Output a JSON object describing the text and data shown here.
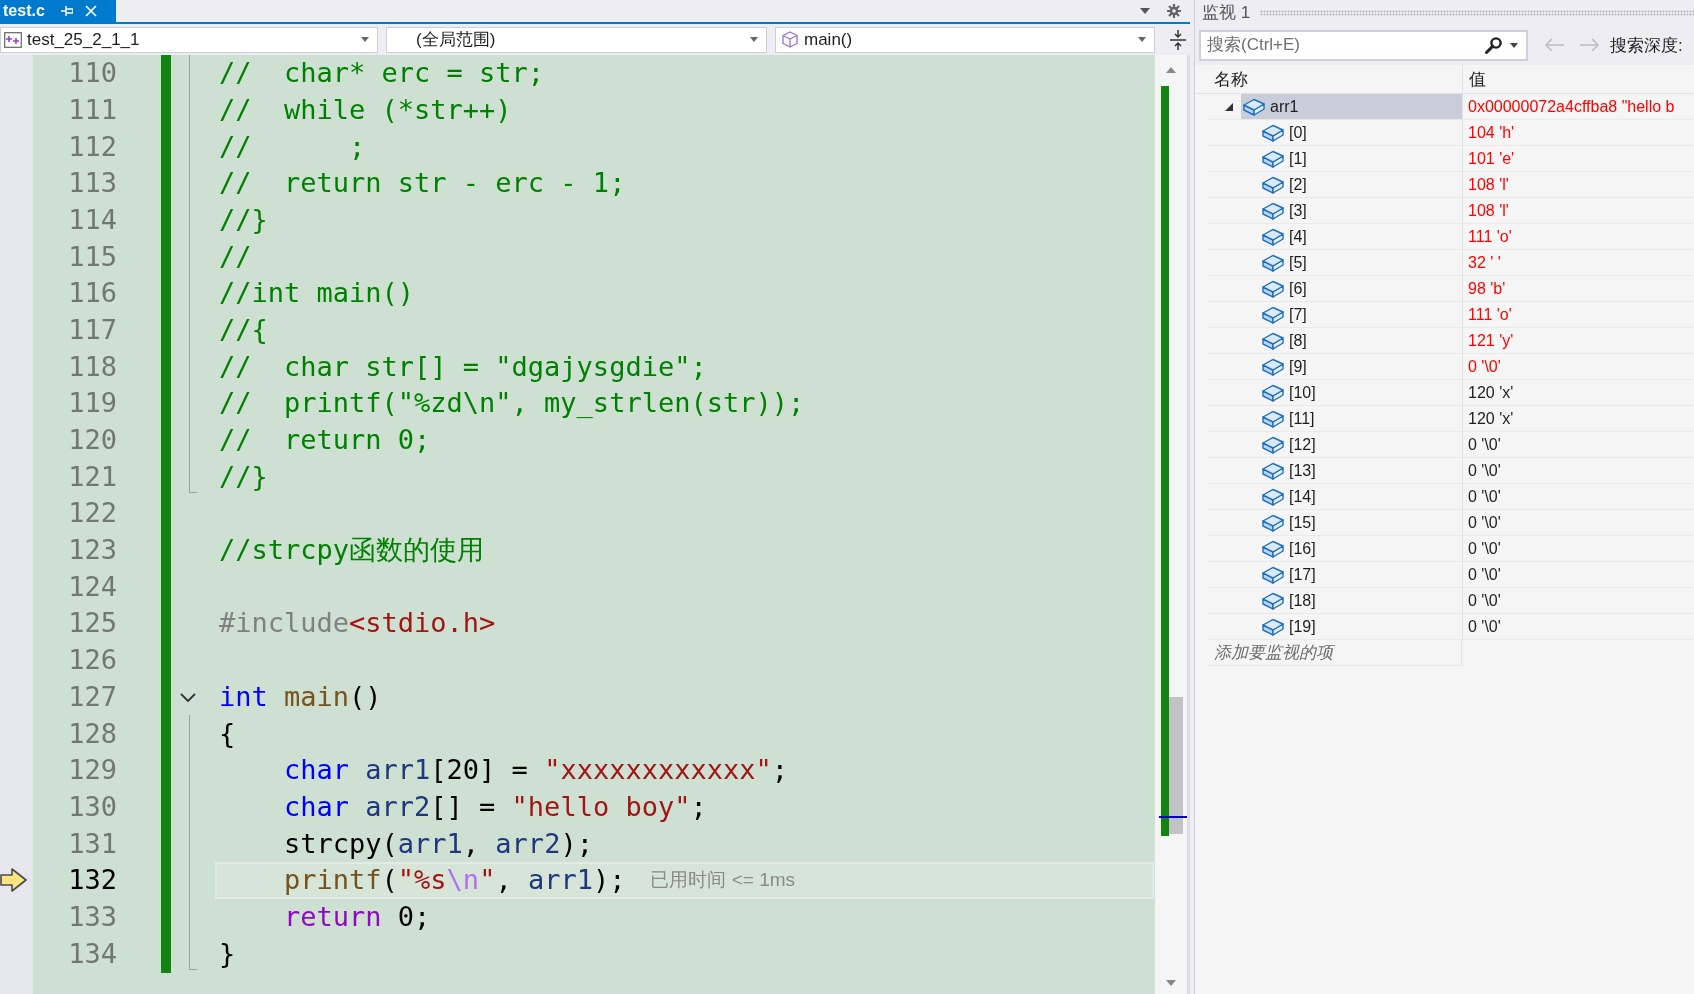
{
  "tabs": [
    {
      "label": "test.c",
      "selected": true
    }
  ],
  "navigation_bar": {
    "project": "test_25_2_1_1",
    "scope": "(全局范围)",
    "member": "main()"
  },
  "code_lines": [
    {
      "number": "110",
      "current": false,
      "kind": "in_block",
      "tokens": [
        {
          "kind": "comment",
          "text": "//  char* erc = str;"
        }
      ]
    },
    {
      "number": "111",
      "current": false,
      "kind": "in_block",
      "tokens": [
        {
          "kind": "comment",
          "text": "//  while (*str++)"
        }
      ]
    },
    {
      "number": "112",
      "current": false,
      "kind": "in_block",
      "tokens": [
        {
          "kind": "comment",
          "text": "//      ;"
        }
      ]
    },
    {
      "number": "113",
      "current": false,
      "kind": "in_block",
      "tokens": [
        {
          "kind": "comment",
          "text": "//  return str - erc - 1;"
        }
      ]
    },
    {
      "number": "114",
      "current": false,
      "kind": "in_block",
      "tokens": [
        {
          "kind": "comment",
          "text": "//}"
        }
      ]
    },
    {
      "number": "115",
      "current": false,
      "kind": "in_block",
      "tokens": [
        {
          "kind": "comment",
          "text": "//"
        }
      ]
    },
    {
      "number": "116",
      "current": false,
      "kind": "in_block",
      "tokens": [
        {
          "kind": "comment",
          "text": "//int main()"
        }
      ]
    },
    {
      "number": "117",
      "current": false,
      "kind": "in_block",
      "tokens": [
        {
          "kind": "comment",
          "text": "//{"
        }
      ]
    },
    {
      "number": "118",
      "current": false,
      "kind": "in_block",
      "tokens": [
        {
          "kind": "comment",
          "text": "//  char str[] = \"dgajysgdie\";"
        }
      ]
    },
    {
      "number": "119",
      "current": false,
      "kind": "in_block",
      "tokens": [
        {
          "kind": "comment",
          "text": "//  printf(\"%zd\\n\", my_strlen(str));"
        }
      ]
    },
    {
      "number": "120",
      "current": false,
      "kind": "in_block",
      "tokens": [
        {
          "kind": "comment",
          "text": "//  return 0;"
        }
      ]
    },
    {
      "number": "121",
      "current": false,
      "kind": "block_end",
      "tokens": [
        {
          "kind": "comment",
          "text": "//}"
        }
      ]
    },
    {
      "number": "122",
      "current": false,
      "kind": "plain"
    },
    {
      "number": "123",
      "current": false,
      "kind": "plain",
      "tokens": [
        {
          "kind": "comment",
          "text": "//strcpy函数的使用"
        }
      ]
    },
    {
      "number": "124",
      "current": false,
      "kind": "plain"
    },
    {
      "number": "125",
      "current": false,
      "kind": "plain",
      "tokens": [
        {
          "kind": "preprocessor",
          "text": "#include"
        },
        {
          "kind": "string",
          "text": "<stdio.h>"
        }
      ]
    },
    {
      "number": "126",
      "current": false,
      "kind": "plain"
    },
    {
      "number": "127",
      "current": false,
      "kind": "fold_start",
      "tokens": [
        {
          "kind": "keyword",
          "text": "int"
        },
        {
          "kind": "function",
          "text": " main"
        },
        {
          "kind": "plain",
          "text": "()"
        }
      ]
    },
    {
      "number": "128",
      "current": false,
      "kind": "in_block",
      "tokens": [
        {
          "kind": "plain",
          "text": "{"
        }
      ]
    },
    {
      "number": "129",
      "current": false,
      "kind": "in_block",
      "tokens": [
        {
          "kind": "keyword",
          "text": "    char"
        },
        {
          "kind": "variable",
          "text": " arr1"
        },
        {
          "kind": "plain",
          "text": "[20] = "
        },
        {
          "kind": "string",
          "text": "\"xxxxxxxxxxxx\""
        },
        {
          "kind": "plain",
          "text": ";"
        }
      ]
    },
    {
      "number": "130",
      "current": false,
      "kind": "in_block",
      "tokens": [
        {
          "kind": "keyword",
          "text": "    char"
        },
        {
          "kind": "variable",
          "text": " arr2"
        },
        {
          "kind": "plain",
          "text": "[] = "
        },
        {
          "kind": "string",
          "text": "\"hello boy\""
        },
        {
          "kind": "plain",
          "text": ";"
        }
      ]
    },
    {
      "number": "131",
      "current": false,
      "kind": "in_block",
      "tokens": [
        {
          "kind": "plain",
          "text": "    strcpy("
        },
        {
          "kind": "variable",
          "text": "arr1"
        },
        {
          "kind": "plain",
          "text": ", "
        },
        {
          "kind": "variable",
          "text": "arr2"
        },
        {
          "kind": "plain",
          "text": ");"
        }
      ]
    },
    {
      "number": "132",
      "current": true,
      "kind": "in_block",
      "hint": "已用时间 <= 1ms",
      "tokens": [
        {
          "kind": "function",
          "text": "    printf"
        },
        {
          "kind": "plain",
          "text": "("
        },
        {
          "kind": "string",
          "text": "\"%s"
        },
        {
          "kind": "escape",
          "text": "\\n"
        },
        {
          "kind": "string",
          "text": "\""
        },
        {
          "kind": "plain",
          "text": ", "
        },
        {
          "kind": "variable",
          "text": "arr1"
        },
        {
          "kind": "plain",
          "text": ");"
        }
      ]
    },
    {
      "number": "133",
      "current": false,
      "kind": "in_block",
      "tokens": [
        {
          "kind": "control",
          "text": "    return"
        },
        {
          "kind": "plain",
          "text": " 0;"
        }
      ]
    },
    {
      "number": "134",
      "current": false,
      "kind": "block_end",
      "tokens": [
        {
          "kind": "plain",
          "text": "}"
        }
      ]
    }
  ],
  "watch_panel": {
    "title": "监视 1",
    "search": {
      "placeholder": "搜索(Ctrl+E)"
    },
    "history_buttons": [
      {
        "kind": "back",
        "disabled": true
      },
      {
        "kind": "forward",
        "disabled": true
      }
    ],
    "search_depth_label": "搜索深度:",
    "columns": [
      "名称",
      "值"
    ],
    "items": [
      {
        "name": "arr1",
        "value": "0x00000072a4cffba8 \"hello b",
        "changed": true,
        "selected": true,
        "expanded": true,
        "children": [
          {
            "name": "[0]",
            "value": "104 'h'",
            "changed": true,
            "selected": false
          },
          {
            "name": "[1]",
            "value": "101 'e'",
            "changed": true,
            "selected": false
          },
          {
            "name": "[2]",
            "value": "108 'l'",
            "changed": true,
            "selected": false
          },
          {
            "name": "[3]",
            "value": "108 'l'",
            "changed": true,
            "selected": false
          },
          {
            "name": "[4]",
            "value": "111 'o'",
            "changed": true,
            "selected": false
          },
          {
            "name": "[5]",
            "value": "32 ' '",
            "changed": true,
            "selected": false
          },
          {
            "name": "[6]",
            "value": "98 'b'",
            "changed": true,
            "selected": false
          },
          {
            "name": "[7]",
            "value": "111 'o'",
            "changed": true,
            "selected": false
          },
          {
            "name": "[8]",
            "value": "121 'y'",
            "changed": true,
            "selected": false
          },
          {
            "name": "[9]",
            "value": "0 '\\0'",
            "changed": true,
            "selected": false
          },
          {
            "name": "[10]",
            "value": "120 'x'",
            "changed": false,
            "selected": false
          },
          {
            "name": "[11]",
            "value": "120 'x'",
            "changed": false,
            "selected": false
          },
          {
            "name": "[12]",
            "value": "0 '\\0'",
            "changed": false,
            "selected": false
          },
          {
            "name": "[13]",
            "value": "0 '\\0'",
            "changed": false,
            "selected": false
          },
          {
            "name": "[14]",
            "value": "0 '\\0'",
            "changed": false,
            "selected": false
          },
          {
            "name": "[15]",
            "value": "0 '\\0'",
            "changed": false,
            "selected": false
          },
          {
            "name": "[16]",
            "value": "0 '\\0'",
            "changed": false,
            "selected": false
          },
          {
            "name": "[17]",
            "value": "0 '\\0'",
            "changed": false,
            "selected": false
          },
          {
            "name": "[18]",
            "value": "0 '\\0'",
            "changed": false,
            "selected": false
          },
          {
            "name": "[19]",
            "value": "0 '\\0'",
            "changed": false,
            "selected": false
          }
        ]
      }
    ],
    "add_item_placeholder": "添加要监视的项"
  }
}
